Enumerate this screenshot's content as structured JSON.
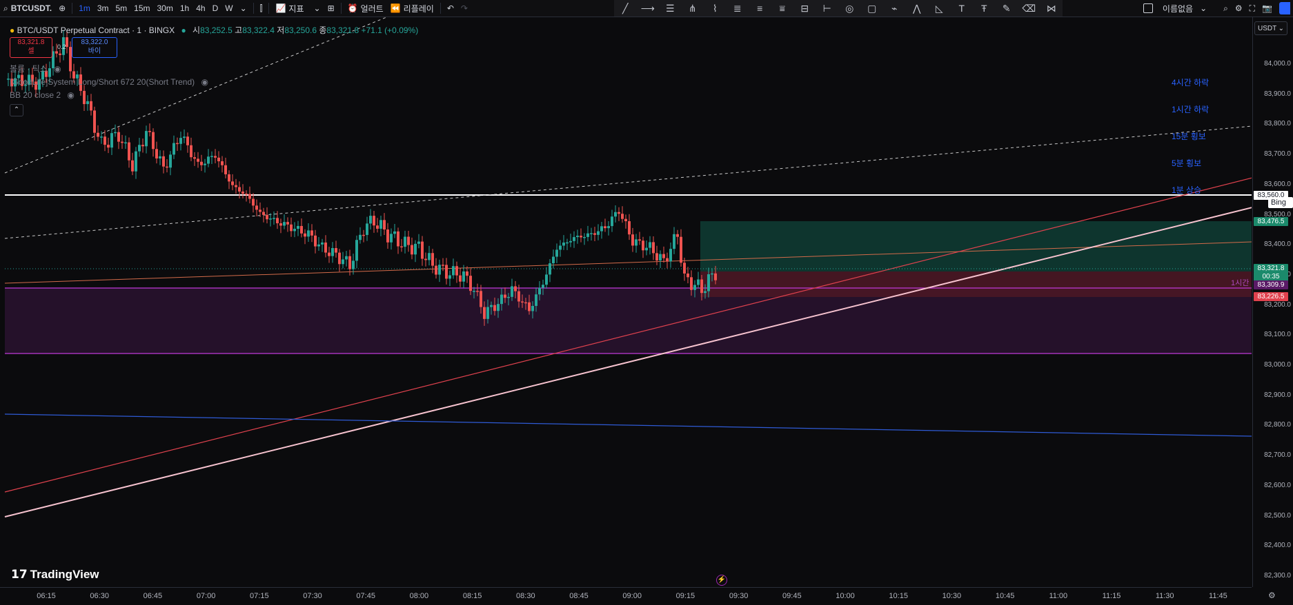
{
  "toolbar": {
    "symbol": "BTCUSDT.",
    "intervals": [
      "1m",
      "3m",
      "5m",
      "15m",
      "30m",
      "1h",
      "4h",
      "D",
      "W"
    ],
    "active_interval": "1m",
    "indicators_label": "지표",
    "alert_label": "얼러트",
    "replay_label": "리플레이",
    "layout_name": "이름없음"
  },
  "legend": {
    "title": "BTC/USDT Perpetual Contract · 1 · BINGX",
    "open_label": "시",
    "open": "83,252.5",
    "high_label": "고",
    "high": "83,322.4",
    "low_label": "저",
    "low": "83,250.6",
    "close_label": "종",
    "close": "83,321.8",
    "change": "+71.1 (+0.09%)",
    "sell_price": "83,321.8",
    "sell_label": "셀",
    "spread": "0.2",
    "buy_price": "83,322.0",
    "buy_label": "바이",
    "volume_label": "볼륨 · 틱스",
    "indicator1": "[GoodLife]System Long/Short 672 20(Short Trend)",
    "indicator2": "BB 20 close 2"
  },
  "trend_notes": [
    "4시간 하락",
    "1시간 하락",
    "15분 횡보",
    "5분 횡보",
    "1분 상승"
  ],
  "price_axis": {
    "currency": "USDT",
    "labels": [
      "84,000.0",
      "83,900.0",
      "83,800.0",
      "83,700.0",
      "83,600.0",
      "83,500.0",
      "83,400.0",
      "83,300.0",
      "83,200.0",
      "83,100.0",
      "83,000.0",
      "82,900.0",
      "82,800.0",
      "82,700.0",
      "82,600.0",
      "82,500.0",
      "82,400.0",
      "82,300.0"
    ],
    "tag_white": "83,560.0",
    "tag_green_top": "83,476.5",
    "tag_last": "83,321.8",
    "tag_countdown": "00:35",
    "tag_purple": "83,309.9",
    "tag_red": "83,226.5",
    "bing_label": "Bing"
  },
  "time_axis": {
    "labels": [
      "06:15",
      "06:30",
      "06:45",
      "07:00",
      "07:15",
      "07:30",
      "07:45",
      "08:00",
      "08:15",
      "08:30",
      "08:45",
      "09:00",
      "09:15",
      "09:30",
      "09:45",
      "10:00",
      "10:15",
      "10:30",
      "10:45",
      "11:00",
      "11:15",
      "11:30",
      "11:45"
    ]
  },
  "hour_label": "1시간",
  "brand": "TradingView",
  "colors": {
    "up": "#26a69a",
    "down": "#ef5350",
    "purple": "#9c27b0",
    "accent": "#2962ff"
  }
}
